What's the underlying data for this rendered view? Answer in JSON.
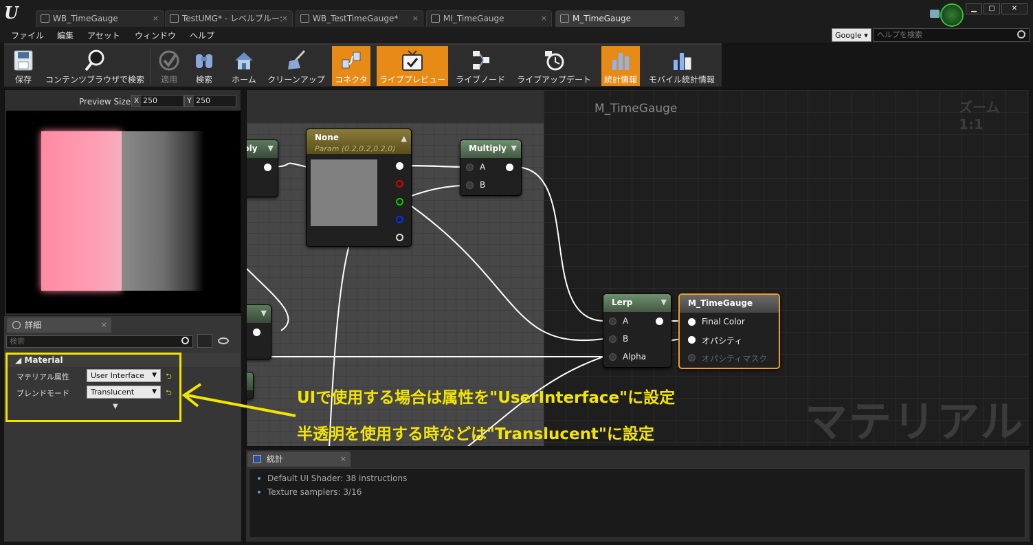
{
  "tabs": [
    {
      "label": "WB_TimeGauge",
      "active": false
    },
    {
      "label": "TestUMG* - レベルブルー:",
      "active": false
    },
    {
      "label": "WB_TestTimeGauge*",
      "active": false
    },
    {
      "label": "MI_TimeGauge",
      "active": false
    },
    {
      "label": "M_TimeGauge",
      "active": true
    }
  ],
  "tab_close": "×",
  "menu": [
    "ファイル",
    "編集",
    "アセット",
    "ウィンドウ",
    "ヘルプ"
  ],
  "help": {
    "engine": "Google",
    "placeholder": "ヘルプを検索"
  },
  "toolbar": {
    "save": "保存",
    "browse": "コンテンツブラウザで検索",
    "apply": "適用",
    "search": "検索",
    "home": "ホーム",
    "cleanup": "クリーンアップ",
    "connectors": "コネクタ",
    "live_preview": "ライブプレビュー",
    "live_nodes": "ライブノード",
    "live_update": "ライブアップデート",
    "stats": "統計情報",
    "mobile_stats": "モバイル統計情報"
  },
  "preview": {
    "size_label": "Preview Size",
    "x_label": "X",
    "x_value": "250",
    "y_label": "Y",
    "y_value": "250"
  },
  "details": {
    "tab": "詳細",
    "search_placeholder": "検索",
    "section": "Material",
    "rows": [
      {
        "label": "マテリアル属性",
        "value": "User Interface"
      },
      {
        "label": "ブレンドモード",
        "value": "Translucent"
      }
    ]
  },
  "graph": {
    "title": "M_TimeGauge",
    "zoom": "ズーム 1:1",
    "watermark": "マテリアル",
    "nodes": {
      "partial_top": "ply",
      "param": {
        "title": "None",
        "subtitle": "Param (0.2,0.2,0.2,0)"
      },
      "multiply": {
        "title": "Multiply",
        "pin_a": "A",
        "pin_b": "B"
      },
      "lerp": {
        "title": "Lerp",
        "pin_a": "A",
        "pin_b": "B",
        "pin_alpha": "Alpha"
      },
      "output": {
        "title": "M_TimeGauge",
        "pins": [
          "Final Color",
          "オパシティ",
          "オパシティマスク"
        ]
      }
    }
  },
  "stats": {
    "tab": "統計",
    "lines": [
      "Default UI Shader: 38 instructions",
      "Texture samplers: 3/16"
    ]
  },
  "annotations": [
    "UIで使用する場合は属性を\"UserInterface\"に設定",
    "半透明を使用する時などは\"Translucent\"に設定"
  ],
  "colors": {
    "accent": "#e88a16",
    "highlight": "#f4e500",
    "preview_pink": "#ff8aa2"
  }
}
